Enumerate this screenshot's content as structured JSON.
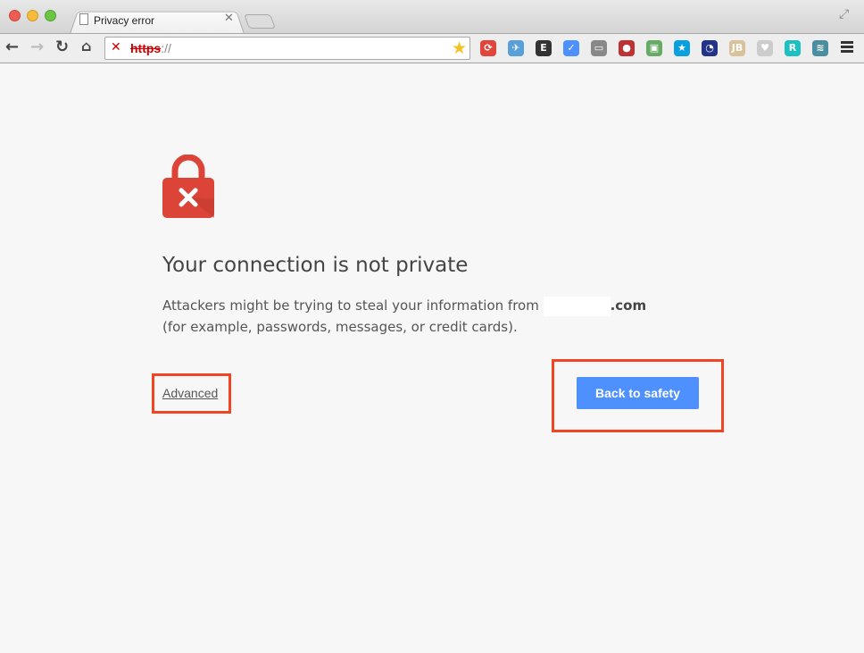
{
  "tab": {
    "title": "Privacy error"
  },
  "omnibox": {
    "scheme": "https",
    "rest": "://"
  },
  "extensions": [
    {
      "name": "sync-icon",
      "color": "#e0463c",
      "glyph": "⟳"
    },
    {
      "name": "bird-icon",
      "color": "#5aa0d8",
      "glyph": "✈"
    },
    {
      "name": "evernote-icon",
      "color": "#333333",
      "glyph": "E"
    },
    {
      "name": "check-icon",
      "color": "#4d90fe",
      "glyph": "✓"
    },
    {
      "name": "cast-icon",
      "color": "#888888",
      "glyph": "▭"
    },
    {
      "name": "gauge-red-icon",
      "color": "#b33",
      "glyph": "●"
    },
    {
      "name": "monitor-icon",
      "color": "#6a6",
      "glyph": "▣"
    },
    {
      "name": "star-circle-icon",
      "color": "#0aa0e0",
      "glyph": "★"
    },
    {
      "name": "speedometer-icon",
      "color": "#223388",
      "glyph": "◔"
    },
    {
      "name": "jb-icon",
      "color": "#d9c29a",
      "glyph": "JB"
    },
    {
      "name": "heart-card-icon",
      "color": "#cccccc",
      "glyph": "♥"
    },
    {
      "name": "r-icon",
      "color": "#1cc1c1",
      "glyph": "R"
    },
    {
      "name": "wave-icon",
      "color": "#4a8ea0",
      "glyph": "≋"
    }
  ],
  "main": {
    "heading": "Your connection is not private",
    "para_before": "Attackers might be trying to steal your information from ",
    "domain_suffix": ".com",
    "para_after": " (for example, passwords, messages, or credit cards).",
    "advanced": "Advanced",
    "back": "Back to safety"
  },
  "colors": {
    "accent": "#4d90fe",
    "lock": "#db4437",
    "highlight": "#f04423"
  }
}
